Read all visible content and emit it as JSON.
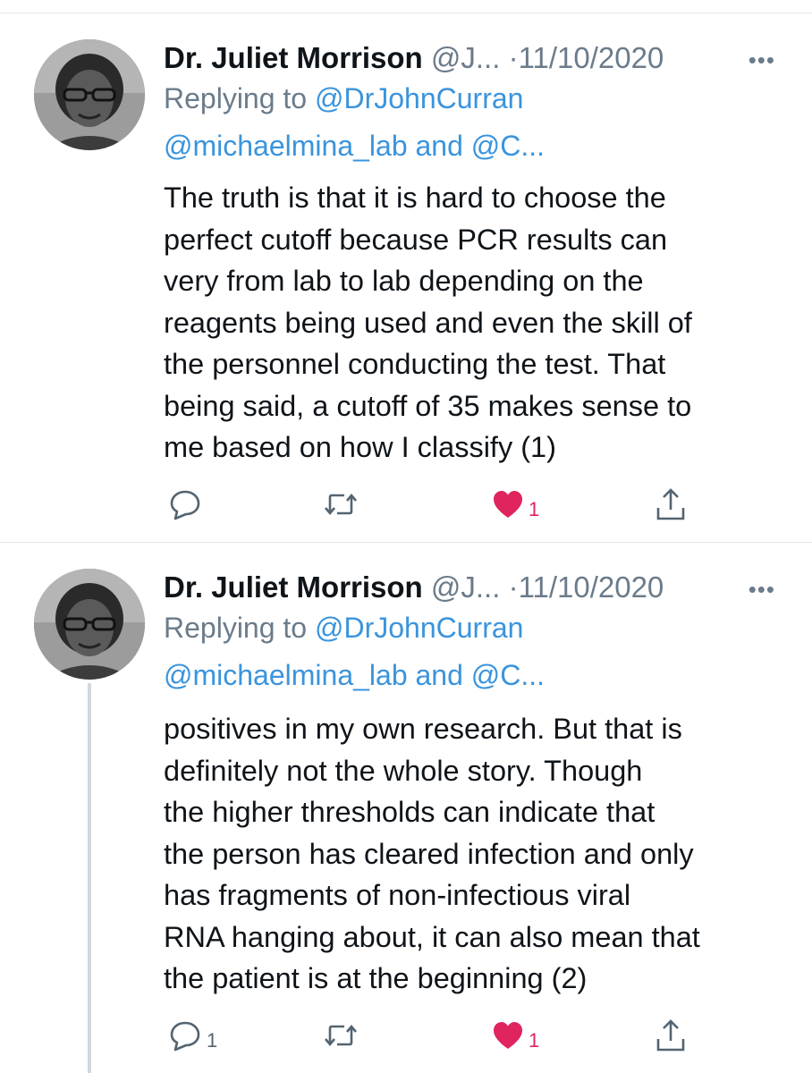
{
  "tweets": [
    {
      "author": {
        "display_name": "Dr. Juliet Morrison",
        "handle": "@J...",
        "avatar_icon": "profile-photo"
      },
      "separator": "·",
      "date": "11/10/2020",
      "more_icon": "more-icon",
      "reply": {
        "prefix": "Replying to",
        "target": "@DrJohnCurran",
        "others": "@michaelmina_lab and @C..."
      },
      "body_lines": [
        "The truth is that it is hard to choose the",
        "perfect cutoff because PCR results can",
        "very from lab to lab depending on the",
        "reagents being used and even the skill of",
        "the personnel conducting the test. That",
        "being said, a cutoff of 35 makes sense to",
        "me based on how I classify (1)"
      ],
      "actions": {
        "reply_count": "",
        "retweet_count": "",
        "like_count": "1",
        "liked": true
      }
    },
    {
      "author": {
        "display_name": "Dr. Juliet Morrison",
        "handle": "@J...",
        "avatar_icon": "profile-photo"
      },
      "separator": "·",
      "date": "11/10/2020",
      "more_icon": "more-icon",
      "reply": {
        "prefix": "Replying to",
        "target": "@DrJohnCurran",
        "others": "@michaelmina_lab and @C..."
      },
      "body_lines": [
        "positives in my own research. But that is",
        "definitely not the whole story. Though",
        "the higher thresholds can indicate that",
        "the person has cleared infection and only",
        "has fragments of non-infectious viral",
        "RNA hanging about, it can also mean that",
        "the patient is at the beginning (2)"
      ],
      "actions": {
        "reply_count": "1",
        "retweet_count": "",
        "like_count": "1",
        "liked": true
      }
    }
  ],
  "colors": {
    "text": "#0f1419",
    "muted": "#6b7b8a",
    "link": "#3a94dd",
    "like": "#e0245e",
    "thread_line": "#cfd9de"
  }
}
